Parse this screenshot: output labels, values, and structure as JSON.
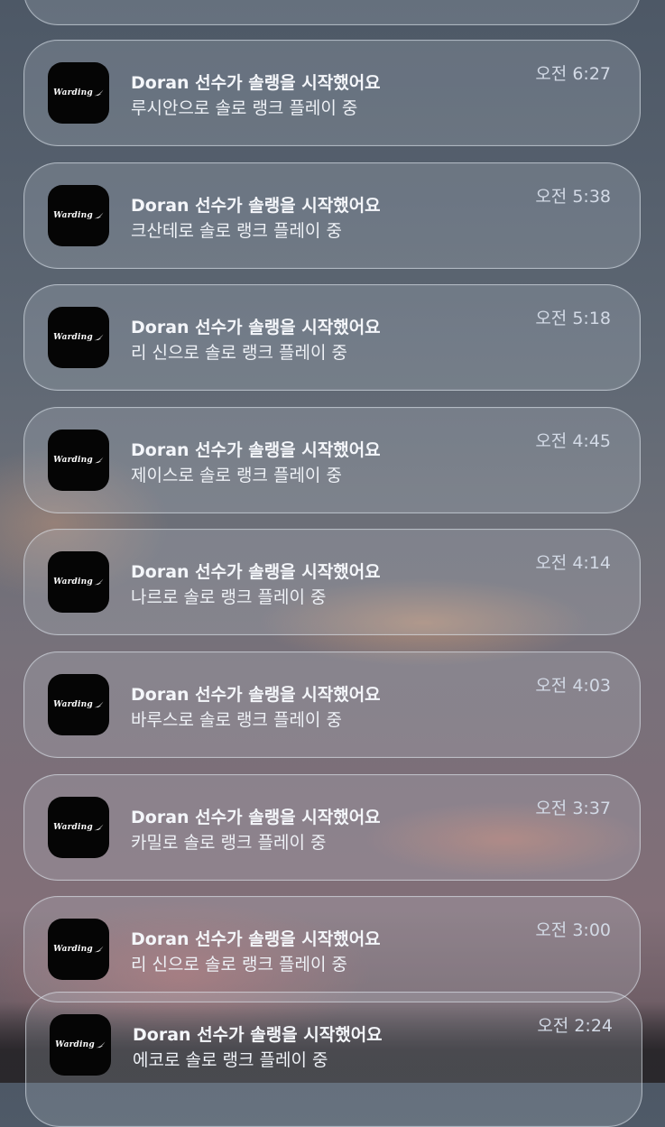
{
  "app": {
    "icon_name": "warding-app-icon",
    "icon_text": "Warding"
  },
  "notifications": [
    {
      "title": "Doran 선수가 솔랭을 시작했어요",
      "body": "루시안으로 솔로 랭크 플레이 중",
      "time": "오전 6:27"
    },
    {
      "title": "Doran 선수가 솔랭을 시작했어요",
      "body": "크산테로 솔로 랭크 플레이 중",
      "time": "오전 5:38"
    },
    {
      "title": "Doran 선수가 솔랭을 시작했어요",
      "body": "리 신으로 솔로 랭크 플레이 중",
      "time": "오전 5:18"
    },
    {
      "title": "Doran 선수가 솔랭을 시작했어요",
      "body": "제이스로 솔로 랭크 플레이 중",
      "time": "오전 4:45"
    },
    {
      "title": "Doran 선수가 솔랭을 시작했어요",
      "body": "나르로 솔로 랭크 플레이 중",
      "time": "오전 4:14"
    },
    {
      "title": "Doran 선수가 솔랭을 시작했어요",
      "body": "바루스로 솔로 랭크 플레이 중",
      "time": "오전 4:03"
    },
    {
      "title": "Doran 선수가 솔랭을 시작했어요",
      "body": "카밀로 솔로 랭크 플레이 중",
      "time": "오전 3:37"
    },
    {
      "title": "Doran 선수가 솔랭을 시작했어요",
      "body": "리 신으로 솔로 랭크 플레이 중",
      "time": "오전 3:00"
    },
    {
      "title": "Doran 선수가 솔랭을 시작했어요",
      "body": "에코로 솔로 랭크 플레이 중",
      "time": "오전 2:24"
    }
  ]
}
